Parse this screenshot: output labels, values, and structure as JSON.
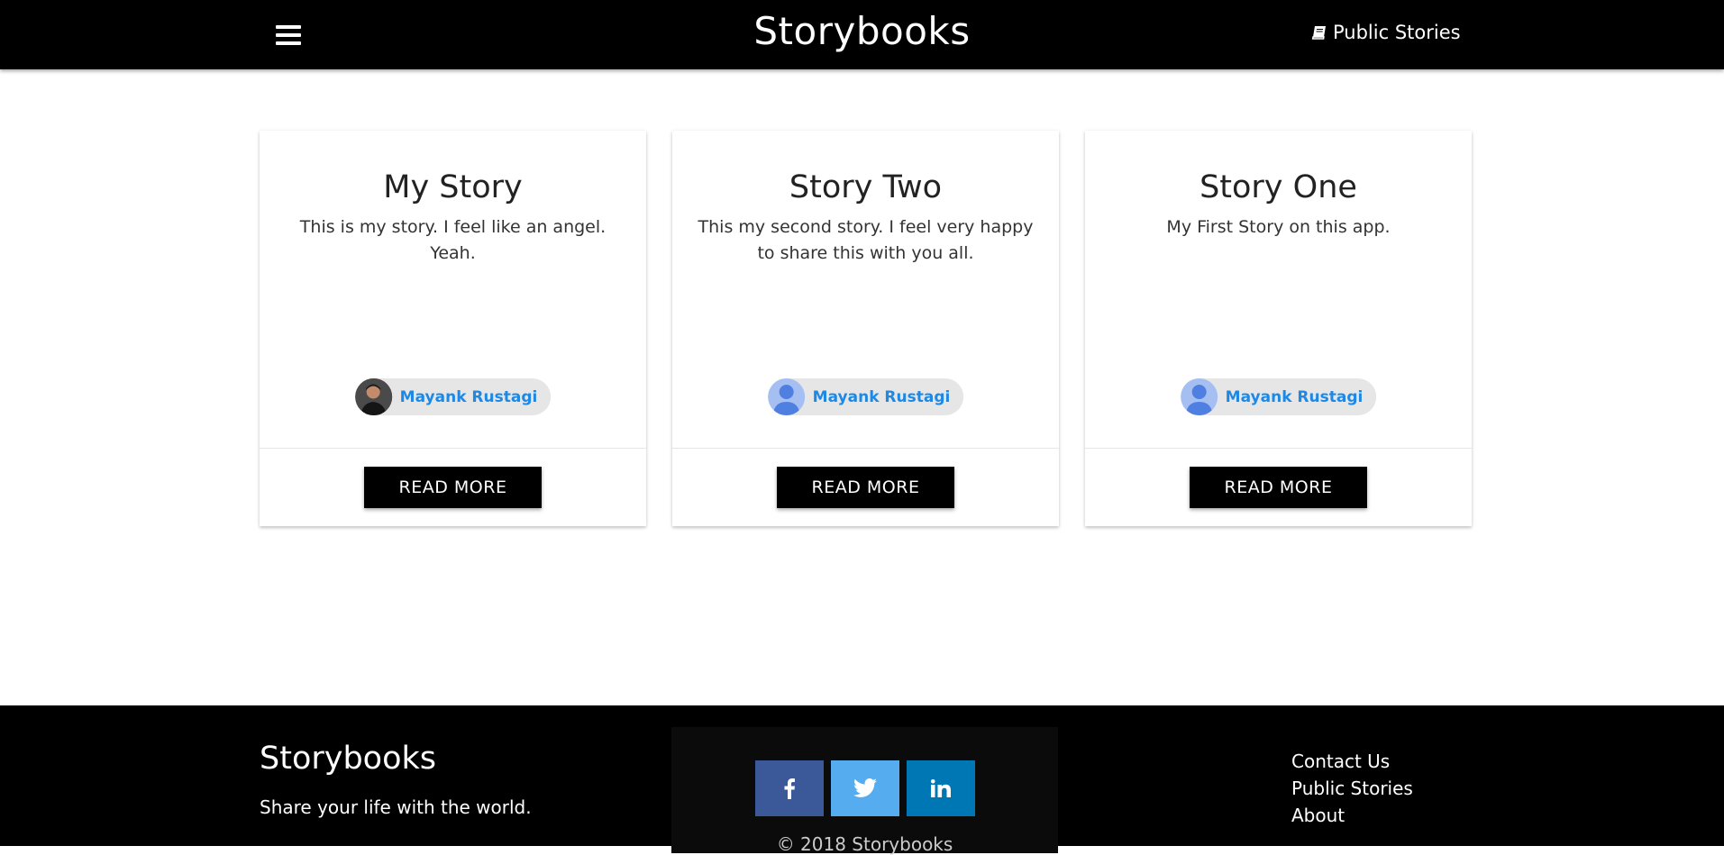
{
  "navbar": {
    "brand": "Storybooks",
    "public_stories_label": "Public Stories"
  },
  "stories": [
    {
      "title": "My Story",
      "body": "This is my story. I feel like an angel. Yeah.",
      "author": "Mayank Rustagi",
      "avatar": "photo",
      "button": "READ MORE"
    },
    {
      "title": "Story Two",
      "body": "This my second story. I feel very happy to share this with you all.",
      "author": "Mayank Rustagi",
      "avatar": "default-user",
      "button": "READ MORE"
    },
    {
      "title": "Story One",
      "body": "My First Story on this app.",
      "author": "Mayank Rustagi",
      "avatar": "default-user",
      "button": "READ MORE"
    }
  ],
  "footer": {
    "brand": "Storybooks",
    "tagline": "Share your life with the world.",
    "copyright": "© 2018 Storybooks",
    "social": [
      {
        "icon": "facebook-icon",
        "color": "#3b5998"
      },
      {
        "icon": "twitter-icon",
        "color": "#55acee"
      },
      {
        "icon": "linkedin-icon",
        "color": "#0077b5"
      }
    ],
    "links": [
      "Contact Us",
      "Public Stories",
      "About"
    ]
  },
  "colors": {
    "nav_bg": "#000000",
    "chip_name": "#1e88e5",
    "chip_bg": "#e6e6e6",
    "avatar_default": "#a6bff2"
  }
}
